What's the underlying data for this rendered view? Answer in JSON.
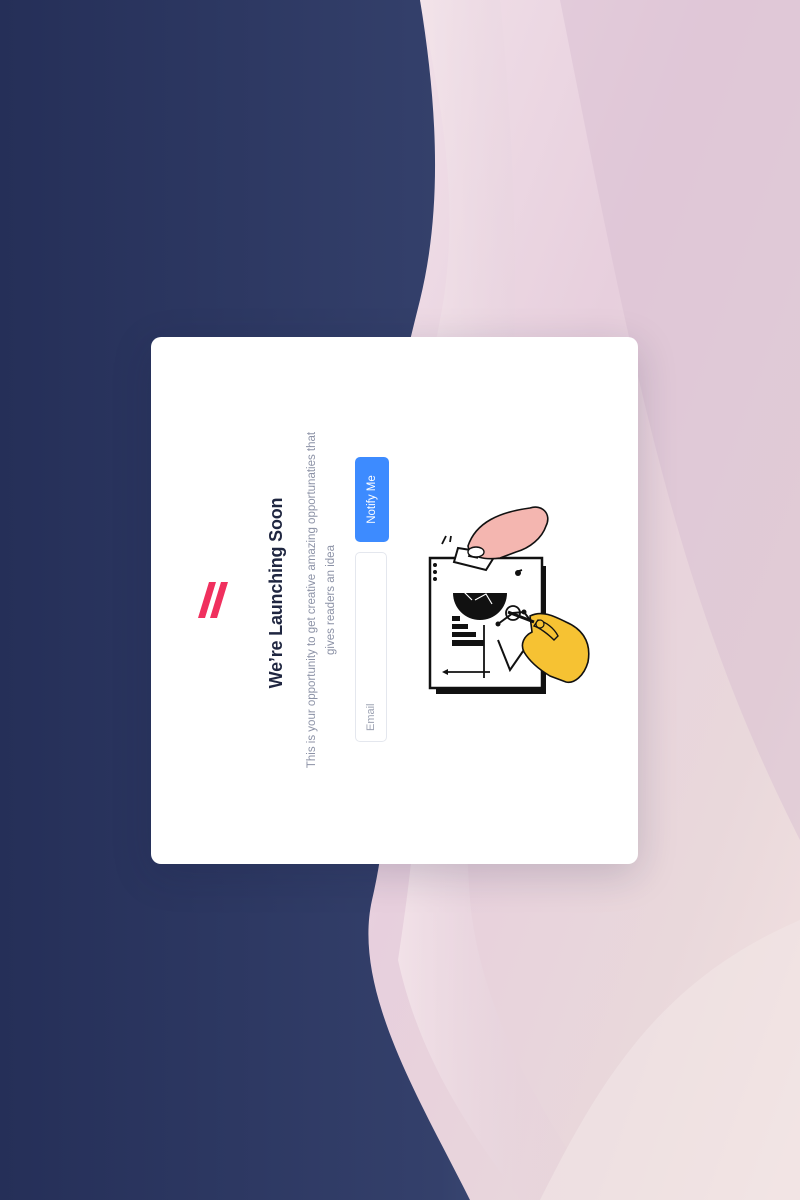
{
  "page": {
    "title": "We’re Launching Soon",
    "description": "This is your opportunity to get creative amazing opportunaties that gives readers an idea"
  },
  "form": {
    "email_placeholder": "Email",
    "email_value": "",
    "submit_label": "Notify Me"
  },
  "icons": {
    "logo": "brand-logo-icon",
    "illustration": "analytics-illustration"
  },
  "colors": {
    "accent": "#3d8bff",
    "brand": "#f0305e",
    "heading": "#1f2640",
    "muted_text": "#8c92a6",
    "background_dark": "#26305a",
    "background_light": "#ead6e1",
    "illustration_hand_pink": "#f4b6b0",
    "illustration_hand_yellow": "#f6c233"
  }
}
